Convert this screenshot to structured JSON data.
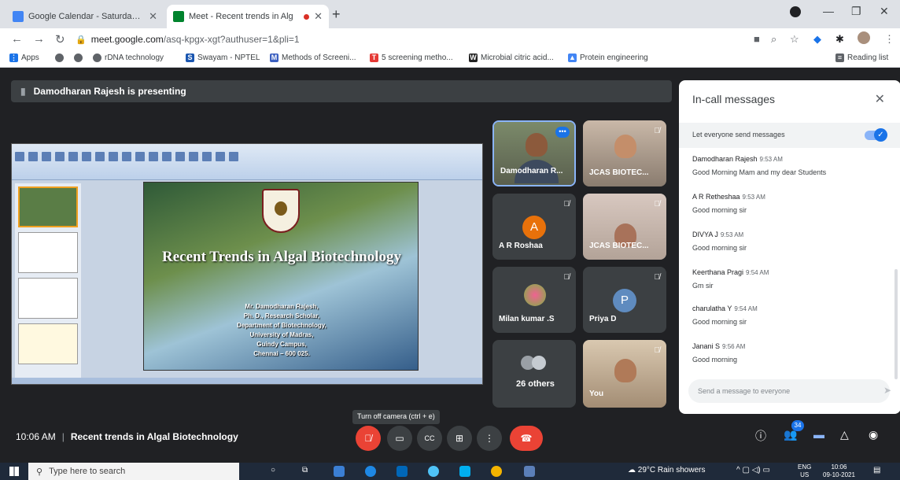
{
  "browser": {
    "tabs": [
      {
        "title": "Google Calendar - Saturday, Oc",
        "active": false
      },
      {
        "title": "Meet - Recent trends in Alg",
        "active": true
      }
    ],
    "url_host": "meet.google.com",
    "url_path": "/asq-kpgx-xgt?authuser=1&pli=1",
    "bookmarks": [
      "Apps",
      "rDNA technology",
      "Swayam - NPTEL",
      "Methods of Screeni...",
      "5 screening metho...",
      "Microbial citric acid...",
      "Protein engineering"
    ],
    "reading_list": "Reading list"
  },
  "meet": {
    "presenting_banner": "Damodharan Rajesh is presenting",
    "slide": {
      "title": "Recent Trends in Algal Biotechnology",
      "lines": [
        "Mr. Damodharan Rajesh,",
        "Ph. D., Research Scholar,",
        "Department of Biotechnology,",
        "University of Madras,",
        "Guindy Campus,",
        "Chennai – 600 025."
      ]
    },
    "participants": [
      {
        "name": "Damodharan R...",
        "type": "video"
      },
      {
        "name": "JCAS BIOTEC...",
        "type": "video"
      },
      {
        "name": "A R Roshaa",
        "initial": "A",
        "color": "#e8710a"
      },
      {
        "name": "JCAS BIOTEC...",
        "type": "video"
      },
      {
        "name": "Milan kumar .S",
        "type": "image"
      },
      {
        "name": "Priya D",
        "initial": "P",
        "color": "#5f8bbf"
      },
      {
        "name": "26 others",
        "type": "group"
      },
      {
        "name": "You",
        "type": "video"
      }
    ],
    "tooltip": "Turn off camera (ctrl + e)",
    "time": "10:06 AM",
    "meeting_title": "Recent trends in Algal Biotechnology",
    "people_count": "34"
  },
  "chat": {
    "header": "In-call messages",
    "toggle_label": "Let everyone send messages",
    "messages": [
      {
        "sender": "Damodharan Rajesh",
        "time": "9:53 AM",
        "text": "Good Morning Mam and my dear Students"
      },
      {
        "sender": "A R Retheshaa",
        "time": "9:53 AM",
        "text": "Good morning sir"
      },
      {
        "sender": "DIVYA J",
        "time": "9:53 AM",
        "text": "Good morning sir"
      },
      {
        "sender": "Keerthana Pragi",
        "time": "9:54 AM",
        "text": "Gm sir"
      },
      {
        "sender": "charulatha Y",
        "time": "9:54 AM",
        "text": "Good morning sir"
      },
      {
        "sender": "Janani S",
        "time": "9:56 AM",
        "text": "Good morning"
      }
    ],
    "input_placeholder": "Send a message to everyone"
  },
  "taskbar": {
    "search_placeholder": "Type here to search",
    "weather": "29°C  Rain showers",
    "lang_top": "ENG",
    "lang_bottom": "US",
    "clock_time": "10:06",
    "clock_date": "09-10-2021"
  }
}
